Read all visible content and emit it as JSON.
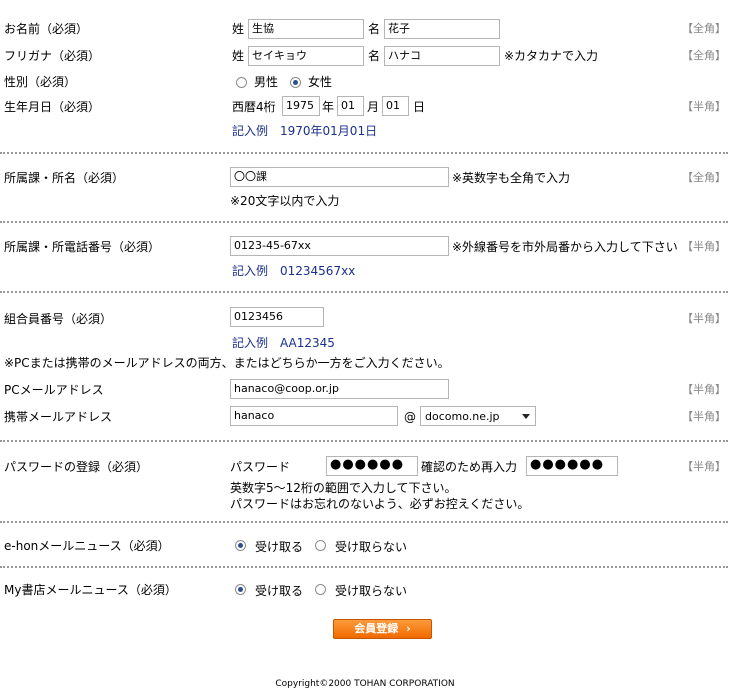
{
  "tag_zenkaku": "【全角】",
  "tag_hankaku": "【半角】",
  "name": {
    "label": "お名前（必須）",
    "sei_prefix": "姓",
    "sei_value": "生協",
    "mei_prefix": "名",
    "mei_value": "花子"
  },
  "kana": {
    "label": "フリガナ（必須）",
    "sei_prefix": "姓",
    "sei_value": "セイキョウ",
    "mei_prefix": "名",
    "mei_value": "ハナコ",
    "note": "※カタカナで入力"
  },
  "gender": {
    "label": "性別（必須）",
    "options": [
      "男性",
      "女性"
    ],
    "selected": "女性"
  },
  "birth": {
    "label": "生年月日（必須）",
    "prefix": "西暦4桁",
    "year": "1975",
    "year_unit": "年",
    "month": "01",
    "month_unit": "月",
    "day": "01",
    "day_unit": "日",
    "example": "記入例　1970年01月01日"
  },
  "dept": {
    "label": "所属課・所名（必須）",
    "value": "〇〇課",
    "note": "※英数字も全角で入力",
    "note2": "※20文字以内で入力"
  },
  "phone": {
    "label": "所属課・所電話番号（必須）",
    "value": "0123-45-67xx",
    "note": "※外線番号を市外局番から入力して下さい",
    "example": "記入例　01234567xx"
  },
  "member": {
    "label": "組合員番号（必須）",
    "value": "0123456",
    "example": "記入例　AA12345"
  },
  "mail_note": "※PCまたは携帯のメールアドレスの両方、またはどちらか一方をご入力ください。",
  "pc_mail": {
    "label": "PCメールアドレス",
    "value": "hanaco@coop.or.jp"
  },
  "mobile_mail": {
    "label": "携帯メールアドレス",
    "value": "hanaco",
    "at": "@",
    "domain": "docomo.ne.jp"
  },
  "password": {
    "label": "パスワードの登録（必須）",
    "pw_label": "パスワード",
    "pw_value": "●●●●●●",
    "confirm_label": "確認のため再入力",
    "confirm_value": "●●●●●●",
    "help1": "英数字5～12桁の範囲で入力して下さい。",
    "help2": "パスワードはお忘れのないよう、必ずお控えください。"
  },
  "ehon_news": {
    "label": "e-honメールニュース（必須）",
    "options": [
      "受け取る",
      "受け取らない"
    ],
    "selected": "受け取る"
  },
  "my_news": {
    "label": "My書店メールニュース（必須）",
    "options": [
      "受け取る",
      "受け取らない"
    ],
    "selected": "受け取る"
  },
  "submit_label": "会員登録",
  "submit_chevron": "›",
  "copyright": "Copyright©2000 TOHAN CORPORATION"
}
